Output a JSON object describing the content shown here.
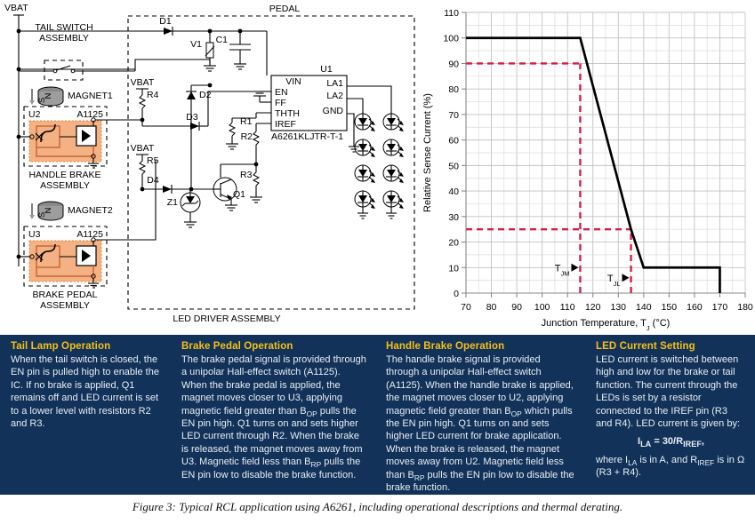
{
  "figure": {
    "caption": "Figure 3: Typical RCL application using A6261, including operational descriptions and thermal derating."
  },
  "circuit": {
    "supply_label_top": "VBAT",
    "pedal_label": "PEDAL",
    "blocks": [
      {
        "name": "tail-switch-assembly",
        "label_line1": "TAIL SWITCH",
        "label_line2": "ASSEMBLY"
      },
      {
        "name": "handle-brake-assembly",
        "label_line1": "HANDLE BRAKE",
        "label_line2": "ASSEMBLY"
      },
      {
        "name": "brake-pedal-assembly",
        "label_line1": "BRAKE PEDAL",
        "label_line2": "ASSEMBLY"
      },
      {
        "name": "led-driver-assembly",
        "label_line1": "LED DRIVER ASSEMBLY",
        "label_line2": ""
      }
    ],
    "magnets": [
      {
        "label": "MAGNET1",
        "pole_top": "N",
        "pole_bottom": "S"
      },
      {
        "label": "MAGNET2",
        "pole_top": "N",
        "pole_bottom": "S"
      }
    ],
    "hall_switches": [
      {
        "ref": "U2",
        "part": "A1125"
      },
      {
        "ref": "U3",
        "part": "A1125"
      }
    ],
    "ic": {
      "ref": "U1",
      "part_number": "A6261KLJTR-T-1",
      "pins_left": [
        "EN",
        "FF",
        "THTH",
        "IREF"
      ],
      "pin_top": "VIN",
      "pins_right": [
        "LA1",
        "LA2",
        "GND"
      ]
    },
    "components": [
      {
        "ref": "D1",
        "type": "diode"
      },
      {
        "ref": "D2",
        "type": "diode"
      },
      {
        "ref": "D3",
        "type": "diode"
      },
      {
        "ref": "D4",
        "type": "diode"
      },
      {
        "ref": "V1",
        "type": "varistor"
      },
      {
        "ref": "C1",
        "type": "capacitor"
      },
      {
        "ref": "Z1",
        "type": "zener"
      },
      {
        "ref": "Q1",
        "type": "transistor"
      },
      {
        "ref": "R1",
        "type": "resistor"
      },
      {
        "ref": "R2",
        "type": "resistor"
      },
      {
        "ref": "R3",
        "type": "resistor"
      },
      {
        "ref": "R4",
        "type": "resistor",
        "rail": "VBAT"
      },
      {
        "ref": "R5",
        "type": "resistor",
        "rail": "VBAT"
      }
    ],
    "led_array": {
      "columns": 2,
      "rows": 4
    }
  },
  "chart_data": {
    "type": "line",
    "title": "",
    "xlabel": "Junction Temperature, T_J (°C)",
    "xlabel_main": "Junction Temperature, T",
    "xlabel_sub": "J",
    "xlabel_unit": " (°C)",
    "ylabel": "Relative Sense Current (%)",
    "xlim": [
      70,
      180
    ],
    "ylim": [
      0,
      110
    ],
    "xticks": [
      70,
      80,
      90,
      100,
      110,
      120,
      130,
      140,
      150,
      160,
      170,
      180
    ],
    "yticks": [
      0,
      10,
      20,
      30,
      40,
      50,
      60,
      70,
      80,
      90,
      100,
      110
    ],
    "xminor_step": 5,
    "yminor_step": 5,
    "grid": true,
    "legend": "none",
    "series": [
      {
        "name": "Relative sense current derating",
        "color": "#000000",
        "x": [
          70,
          115,
          135,
          140,
          170,
          170
        ],
        "y": [
          100,
          100,
          25,
          10,
          10,
          0
        ]
      }
    ],
    "guides": [
      {
        "name": "TJM-vertical",
        "type": "vline",
        "x": 115,
        "from_y": 0,
        "to_y": 90,
        "color": "#d61f4a",
        "style": "dashed"
      },
      {
        "name": "90-percent-horizontal",
        "type": "hline",
        "y": 90,
        "from_x": 70,
        "to_x": 115,
        "color": "#d61f4a",
        "style": "dashed"
      },
      {
        "name": "TJL-vertical",
        "type": "vline",
        "x": 135,
        "from_y": 0,
        "to_y": 25,
        "color": "#d61f4a",
        "style": "dashed"
      },
      {
        "name": "25-percent-horizontal",
        "type": "hline",
        "y": 25,
        "from_x": 70,
        "to_x": 135,
        "color": "#d61f4a",
        "style": "dashed"
      }
    ],
    "annotations": [
      {
        "name": "TJM",
        "text": "T",
        "sub": "JM",
        "marker": "▶",
        "x": 115,
        "y": 10
      },
      {
        "name": "TJL",
        "text": "T",
        "sub": "JL",
        "marker": "▶",
        "x": 135,
        "y": 6
      }
    ]
  },
  "descriptions": {
    "accent_title_color": "#f4c01a",
    "panel_color": "#123259",
    "columns": [
      {
        "id": "tail-lamp-operation",
        "title": "Tail Lamp Operation",
        "paragraphs": [
          "When the tail switch is closed, the EN pin is pulled high to enable the IC. If no brake is applied, Q1 remains off and LED current is set to a lower level with resistors R2 and R3."
        ]
      },
      {
        "id": "brake-pedal-operation",
        "title": "Brake Pedal Operation",
        "paragraphs": [
          "The brake pedal signal is provided through a unipolar Hall-effect switch (A1125). When the brake pedal is applied, the magnet moves closer to U3, applying magnetic field greater than B",
          "OP",
          " pulls the EN pin high. Q1 turns on and sets higher LED current through R2. When the brake is released, the magnet moves away from U3. Magnetic field less than B",
          "RP",
          " pulls the EN pin low to disable the brake function."
        ]
      },
      {
        "id": "handle-brake-operation",
        "title": "Handle Brake Operation",
        "paragraphs": [
          "The handle brake signal is provided through a unipolar Hall-effect switch (A1125). When the handle brake is applied, the magnet moves closer to U2, applying magnetic field greater than B",
          "OP",
          " which pulls the EN pin high. Q1 turns on and sets higher LED current for brake application. When the brake is released, the magnet moves away from U2. Magnetic field less than B",
          "RP",
          " pulls the EN pin low to disable the brake function."
        ]
      },
      {
        "id": "led-current-setting",
        "title": "LED Current Setting",
        "paragraphs": [
          "LED current is switched between high and low for the brake or tail function. The current through the LEDs is set by a resistor connected to the IREF pin (R3 and R4). LED current is given by:"
        ],
        "equation": {
          "lhs_main": "I",
          "lhs_sub": "LA",
          "eq": " = 30/R",
          "rhs_sub": "IREF",
          "rhs_tail": ","
        },
        "equation_note_1": "where I",
        "equation_note_1_sub": "LA",
        "equation_note_2": " is in A, and R",
        "equation_note_2_sub": "IREF",
        "equation_note_3": " is in Ω (R3 + R4)."
      }
    ]
  }
}
